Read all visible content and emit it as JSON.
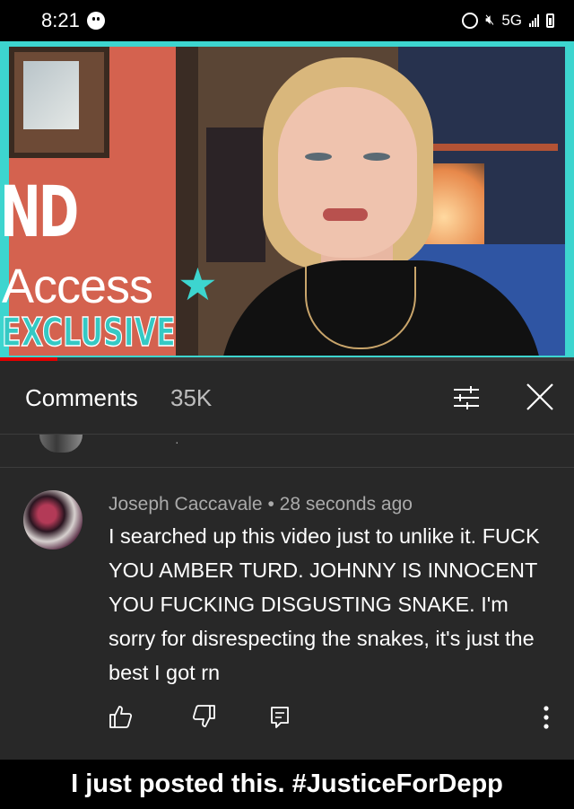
{
  "status_bar": {
    "time": "8:21",
    "network": "5G",
    "icons": [
      "smiley-icon",
      "alarm-icon",
      "mute-icon",
      "signal-icon",
      "battery-icon"
    ]
  },
  "video": {
    "brand_partial": "ND",
    "brand_name": "Access",
    "brand_tag": "EXCLUSIVE",
    "brand_color": "#3dd5cf",
    "progress_fraction": 0.1
  },
  "comments_header": {
    "title": "Comments",
    "count": "35K",
    "icons": [
      "filter-sort-icon",
      "close-icon"
    ]
  },
  "comment": {
    "author": "Joseph Caccavale",
    "separator": "•",
    "time": "28 seconds ago",
    "text": "I searched up this video just to unlike it. FUCK YOU AMBER TURD. JOHNNY IS INNOCENT YOU FUCKING DISGUSTING SNAKE. I'm sorry for disrespecting the snakes, it's just the best I got rn",
    "actions": [
      "like-icon",
      "dislike-icon",
      "reply-icon",
      "more-options-icon"
    ]
  },
  "caption": "I just posted this. #JusticeForDepp",
  "colors": {
    "panel_bg": "#282828",
    "progress": "#e00000",
    "meta_text": "#aaaaaa"
  }
}
